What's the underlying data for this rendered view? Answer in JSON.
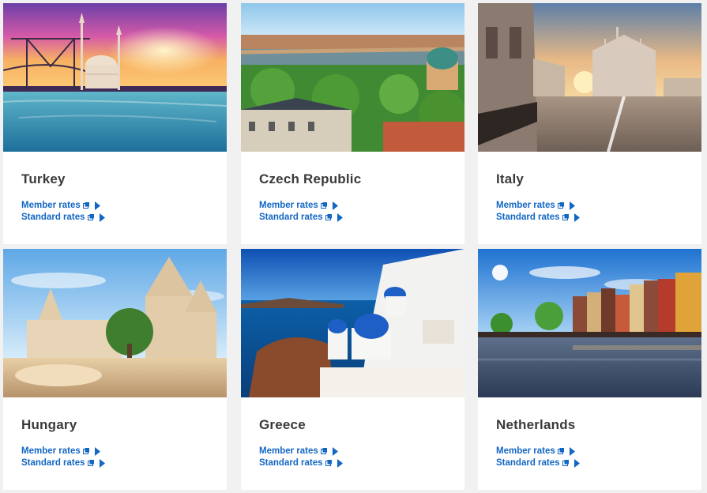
{
  "destinations": [
    {
      "name": "Turkey",
      "member_rates": "Member rates",
      "standard_rates": "Standard rates"
    },
    {
      "name": "Czech Republic",
      "member_rates": "Member rates",
      "standard_rates": "Standard rates"
    },
    {
      "name": "Italy",
      "member_rates": "Member rates",
      "standard_rates": "Standard rates"
    },
    {
      "name": "Hungary",
      "member_rates": "Member rates",
      "standard_rates": "Standard rates"
    },
    {
      "name": "Greece",
      "member_rates": "Member rates",
      "standard_rates": "Standard rates"
    },
    {
      "name": "Netherlands",
      "member_rates": "Member rates",
      "standard_rates": "Standard rates"
    }
  ],
  "colors": {
    "page_background": "#f1f1f1",
    "card_background": "#ffffff",
    "title_text": "#3a3a3a",
    "link_text": "#1266c4"
  },
  "icons": {
    "link_external": "external-link-icon",
    "link_arrow": "play-arrow-icon"
  }
}
